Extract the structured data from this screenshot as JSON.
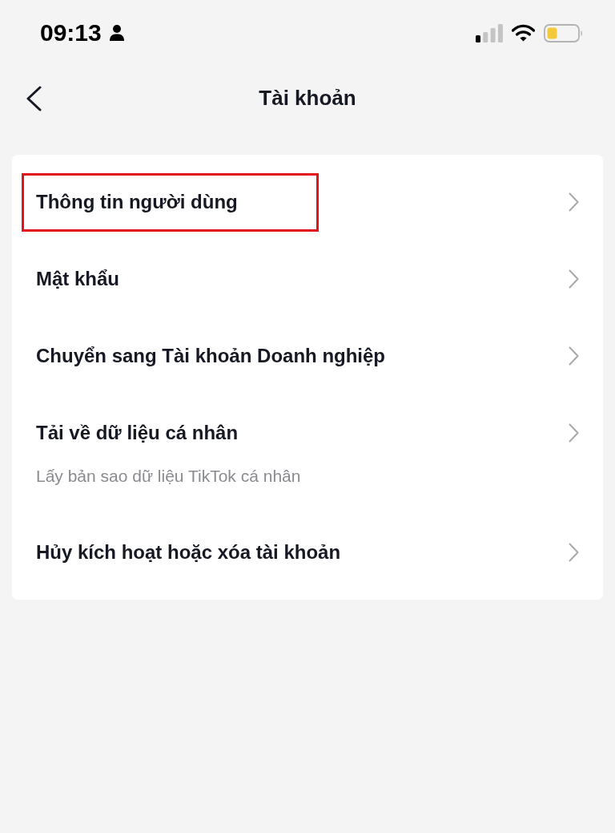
{
  "status_bar": {
    "time": "09:13"
  },
  "header": {
    "title": "Tài khoản"
  },
  "items": [
    {
      "title": "Thông tin người dùng",
      "highlighted": true
    },
    {
      "title": "Mật khẩu",
      "highlighted": false
    },
    {
      "title": "Chuyển sang Tài khoản Doanh nghiệp",
      "highlighted": false
    },
    {
      "title": "Tải về dữ liệu cá nhân",
      "subtitle": "Lấy bản sao dữ liệu TikTok cá nhân",
      "highlighted": false
    },
    {
      "title": "Hủy kích hoạt hoặc xóa tài khoản",
      "highlighted": false
    }
  ]
}
